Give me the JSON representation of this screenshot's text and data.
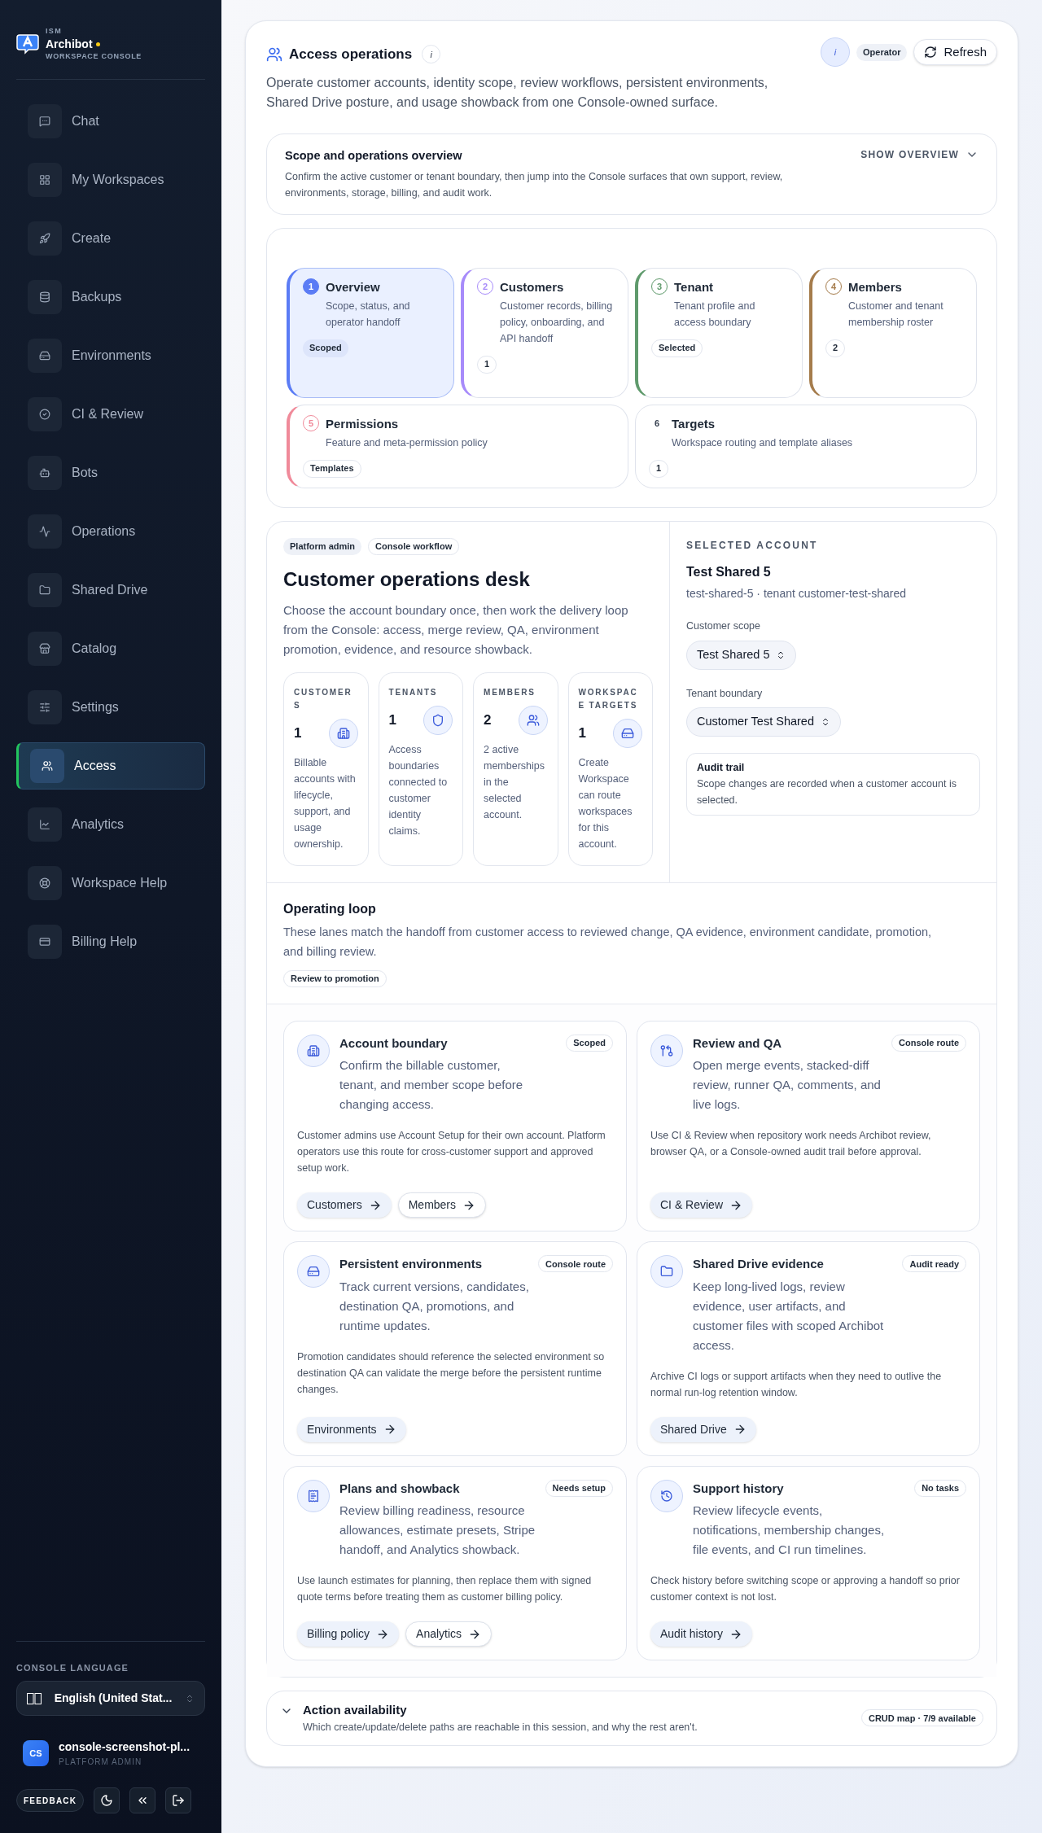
{
  "brand": {
    "eyebrow": "ISM",
    "name": "Archibot",
    "subtitle": "WORKSPACE CONSOLE"
  },
  "sidebar": {
    "items": [
      {
        "label": "Chat",
        "selected": false
      },
      {
        "label": "My Workspaces",
        "selected": false
      },
      {
        "label": "Create",
        "selected": false
      },
      {
        "label": "Backups",
        "selected": false
      },
      {
        "label": "Environments",
        "selected": false
      },
      {
        "label": "CI & Review",
        "selected": false
      },
      {
        "label": "Bots",
        "selected": false
      },
      {
        "label": "Operations",
        "selected": false
      },
      {
        "label": "Shared Drive",
        "selected": false
      },
      {
        "label": "Catalog",
        "selected": false
      },
      {
        "label": "Settings",
        "selected": false
      },
      {
        "label": "Access",
        "selected": true
      },
      {
        "label": "Analytics",
        "selected": false
      },
      {
        "label": "Workspace Help",
        "selected": false
      },
      {
        "label": "Billing Help",
        "selected": false
      }
    ],
    "language_label": "CONSOLE LANGUAGE",
    "language_value": "English (United Stat...",
    "user": {
      "initials": "CS",
      "name": "console-screenshot-pl...",
      "role": "PLATFORM ADMIN"
    },
    "feedback": "FEEDBACK"
  },
  "header": {
    "title": "Access operations",
    "info": "i",
    "avatar": "i",
    "role_badge": "Operator",
    "refresh": "Refresh",
    "description": "Operate customer accounts, identity scope, review workflows, persistent environments, Shared Drive posture, and usage showback from one Console-owned surface."
  },
  "overview": {
    "title": "Scope and operations overview",
    "text": "Confirm the active customer or tenant boundary, then jump into the Console surfaces that own support, review, environments, storage, billing, and audit work.",
    "toggle": "SHOW OVERVIEW",
    "expanded": false
  },
  "steps": [
    {
      "number": "1",
      "title": "Overview",
      "text": "Scope, status, and operator handoff",
      "badge": "Scoped",
      "color": "#5b7cf5",
      "selected": true
    },
    {
      "number": "2",
      "title": "Customers",
      "text": "Customer records, billing policy, onboarding, and API handoff",
      "badge": "1",
      "color": "#a78bfa",
      "selected": false
    },
    {
      "number": "3",
      "title": "Tenant",
      "text": "Tenant profile and access boundary",
      "badge": "Selected",
      "color": "#5f9a6c",
      "selected": false
    },
    {
      "number": "4",
      "title": "Members",
      "text": "Customer and tenant membership roster",
      "badge": "2",
      "color": "#a57c4c",
      "selected": false
    },
    {
      "number": "5",
      "title": "Permissions",
      "text": "Feature and meta-permission policy",
      "badge": "Templates",
      "color": "#f08a9a",
      "selected": false
    },
    {
      "number": "6",
      "title": "Targets",
      "text": "Workspace routing and template aliases",
      "badge": "1",
      "selected": false
    }
  ],
  "desk": {
    "tags": [
      "Platform admin",
      "Console workflow"
    ],
    "title": "Customer operations desk",
    "text": "Choose the account boundary once, then work the delivery loop from the Console: access, merge review, QA, environment promotion, evidence, and resource showback.",
    "stats": [
      {
        "label": "CUSTOMERS",
        "value": "1",
        "text": "Billable accounts with lifecycle, support, and usage ownership."
      },
      {
        "label": "TENANTS",
        "value": "1",
        "text": "Access boundaries connected to customer identity claims."
      },
      {
        "label": "MEMBERS",
        "value": "2",
        "text": "2 active memberships in the selected account."
      },
      {
        "label": "WORKSPACE TARGETS",
        "value": "1",
        "text": "Create Workspace can route workspaces for this account."
      }
    ]
  },
  "selected_account": {
    "label": "SELECTED ACCOUNT",
    "name": "Test Shared 5",
    "detail": "test-shared-5 · tenant customer-test-shared",
    "customer_scope_label": "Customer scope",
    "customer_scope": "Test Shared 5",
    "tenant_label": "Tenant boundary",
    "tenant": "Customer Test Shared",
    "audit_title": "Audit trail",
    "audit_text": "Scope changes are recorded when a customer account is selected."
  },
  "operating_loop": {
    "title": "Operating loop",
    "text": "These lanes match the handoff from customer access to reviewed change, QA evidence, environment candidate, promotion, and billing review.",
    "badge": "Review to promotion",
    "cards": [
      {
        "title": "Account boundary",
        "badge": "Scoped",
        "lead": "Confirm the billable customer, tenant, and member scope before changing access.",
        "note": "Customer admins use Account Setup for their own account. Platform operators use this route for cross-customer support and approved setup work.",
        "actions": [
          {
            "label": "Customers",
            "kind": "filled"
          },
          {
            "label": "Members",
            "kind": "outline"
          }
        ]
      },
      {
        "title": "Review and QA",
        "badge": "Console route",
        "lead": "Open merge events, stacked-diff review, runner QA, comments, and live logs.",
        "note": "Use CI & Review when repository work needs Archibot review, browser QA, or a Console-owned audit trail before approval.",
        "actions": [
          {
            "label": "CI & Review",
            "kind": "filled"
          }
        ]
      },
      {
        "title": "Persistent environments",
        "badge": "Console route",
        "lead": "Track current versions, candidates, destination QA, promotions, and runtime updates.",
        "note": "Promotion candidates should reference the selected environment so destination QA can validate the merge before the persistent runtime changes.",
        "actions": [
          {
            "label": "Environments",
            "kind": "filled"
          }
        ]
      },
      {
        "title": "Shared Drive evidence",
        "badge": "Audit ready",
        "lead": "Keep long-lived logs, review evidence, user artifacts, and customer files with scoped Archibot access.",
        "note": "Archive CI logs or support artifacts when they need to outlive the normal run-log retention window.",
        "actions": [
          {
            "label": "Shared Drive",
            "kind": "filled"
          }
        ]
      },
      {
        "title": "Plans and showback",
        "badge": "Needs setup",
        "lead": "Review billing readiness, resource allowances, estimate presets, Stripe handoff, and Analytics showback.",
        "note": "Use launch estimates for planning, then replace them with signed quote terms before treating them as customer billing policy.",
        "actions": [
          {
            "label": "Billing policy",
            "kind": "filled"
          },
          {
            "label": "Analytics",
            "kind": "outline"
          }
        ]
      },
      {
        "title": "Support history",
        "badge": "No tasks",
        "lead": "Review lifecycle events, notifications, membership changes, file events, and CI run timelines.",
        "note": "Check history before switching scope or approving a handoff so prior customer context is not lost.",
        "actions": [
          {
            "label": "Audit history",
            "kind": "filled"
          }
        ]
      }
    ]
  },
  "action_availability": {
    "title": "Action availability",
    "text": "Which create/update/delete paths are reachable in this session, and why the rest aren't.",
    "badge": "CRUD map · 7/9 available",
    "expanded": false
  }
}
